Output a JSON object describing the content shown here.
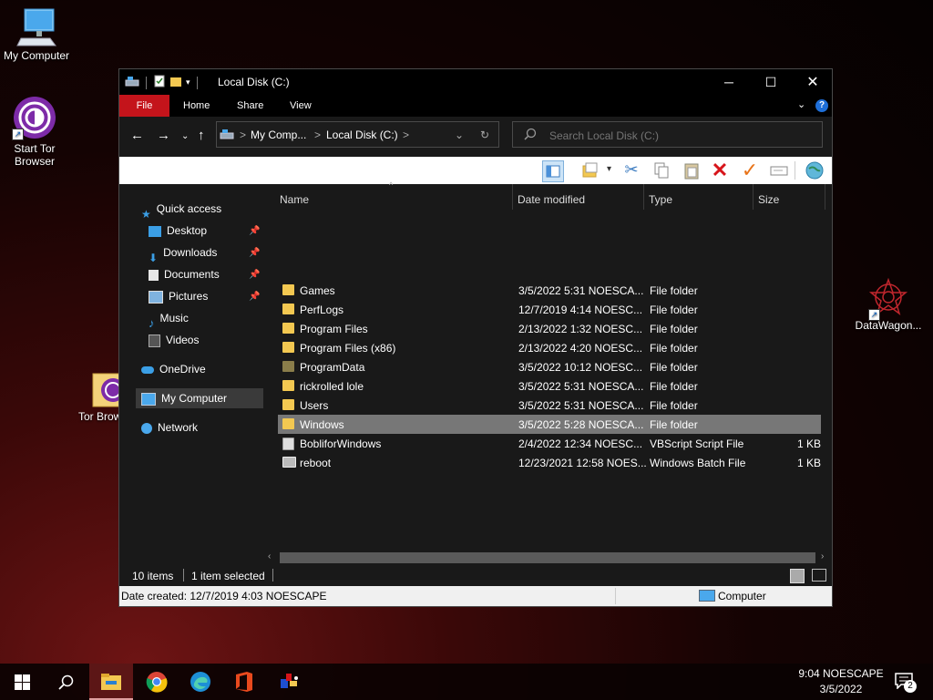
{
  "desktop": {
    "icons": [
      {
        "label": "My Computer"
      },
      {
        "label": "Start Tor Browser"
      },
      {
        "label": "Tor Brow..."
      },
      {
        "label": "DataWagon..."
      }
    ]
  },
  "window": {
    "title": "Local Disk (C:)",
    "ribbon_tabs": [
      "File",
      "Home",
      "Share",
      "View"
    ],
    "address": {
      "crumb1": "My Comp...",
      "crumb2": "Local Disk (C:)",
      "sep": ">"
    },
    "search": {
      "placeholder": "Search Local Disk (C:)"
    },
    "nav": {
      "quick_access": "Quick access",
      "desktop": "Desktop",
      "downloads": "Downloads",
      "documents": "Documents",
      "pictures": "Pictures",
      "music": "Music",
      "videos": "Videos",
      "onedrive": "OneDrive",
      "my_computer": "My Computer",
      "network": "Network"
    },
    "columns": {
      "name": "Name",
      "date": "Date modified",
      "type": "Type",
      "size": "Size"
    },
    "files": [
      {
        "name": "Games",
        "date": "3/5/2022 5:31 NOESCA...",
        "type": "File folder",
        "size": "",
        "kind": "folder"
      },
      {
        "name": "PerfLogs",
        "date": "12/7/2019 4:14 NOESC...",
        "type": "File folder",
        "size": "",
        "kind": "folder"
      },
      {
        "name": "Program Files",
        "date": "2/13/2022 1:32 NOESC...",
        "type": "File folder",
        "size": "",
        "kind": "folder"
      },
      {
        "name": "Program Files (x86)",
        "date": "2/13/2022 4:20 NOESC...",
        "type": "File folder",
        "size": "",
        "kind": "folder"
      },
      {
        "name": "ProgramData",
        "date": "3/5/2022 10:12 NOESC...",
        "type": "File folder",
        "size": "",
        "kind": "folder-hidden"
      },
      {
        "name": "rickrolled lole",
        "date": "3/5/2022 5:31 NOESCA...",
        "type": "File folder",
        "size": "",
        "kind": "folder"
      },
      {
        "name": "Users",
        "date": "3/5/2022 5:31 NOESCA...",
        "type": "File folder",
        "size": "",
        "kind": "folder"
      },
      {
        "name": "Windows",
        "date": "3/5/2022 5:28 NOESCA...",
        "type": "File folder",
        "size": "",
        "kind": "folder",
        "selected": true
      },
      {
        "name": "BobliforWindows",
        "date": "2/4/2022 12:34 NOESC...",
        "type": "VBScript Script File",
        "size": "1 KB",
        "kind": "script"
      },
      {
        "name": "reboot",
        "date": "12/23/2021 12:58 NOES...",
        "type": "Windows Batch File",
        "size": "1 KB",
        "kind": "batch"
      }
    ],
    "status": {
      "items": "10 items",
      "selected": "1 item selected"
    },
    "details": {
      "created": "Date created: 12/7/2019 4:03 NOESCAPE",
      "location": "Computer"
    }
  },
  "taskbar": {
    "time": "9:04 NOESCAPE",
    "date": "3/5/2022",
    "notifications": "2"
  },
  "colors": {
    "file_tab": "#c4141b",
    "folder": "#f3c851",
    "selection": "#777777"
  }
}
